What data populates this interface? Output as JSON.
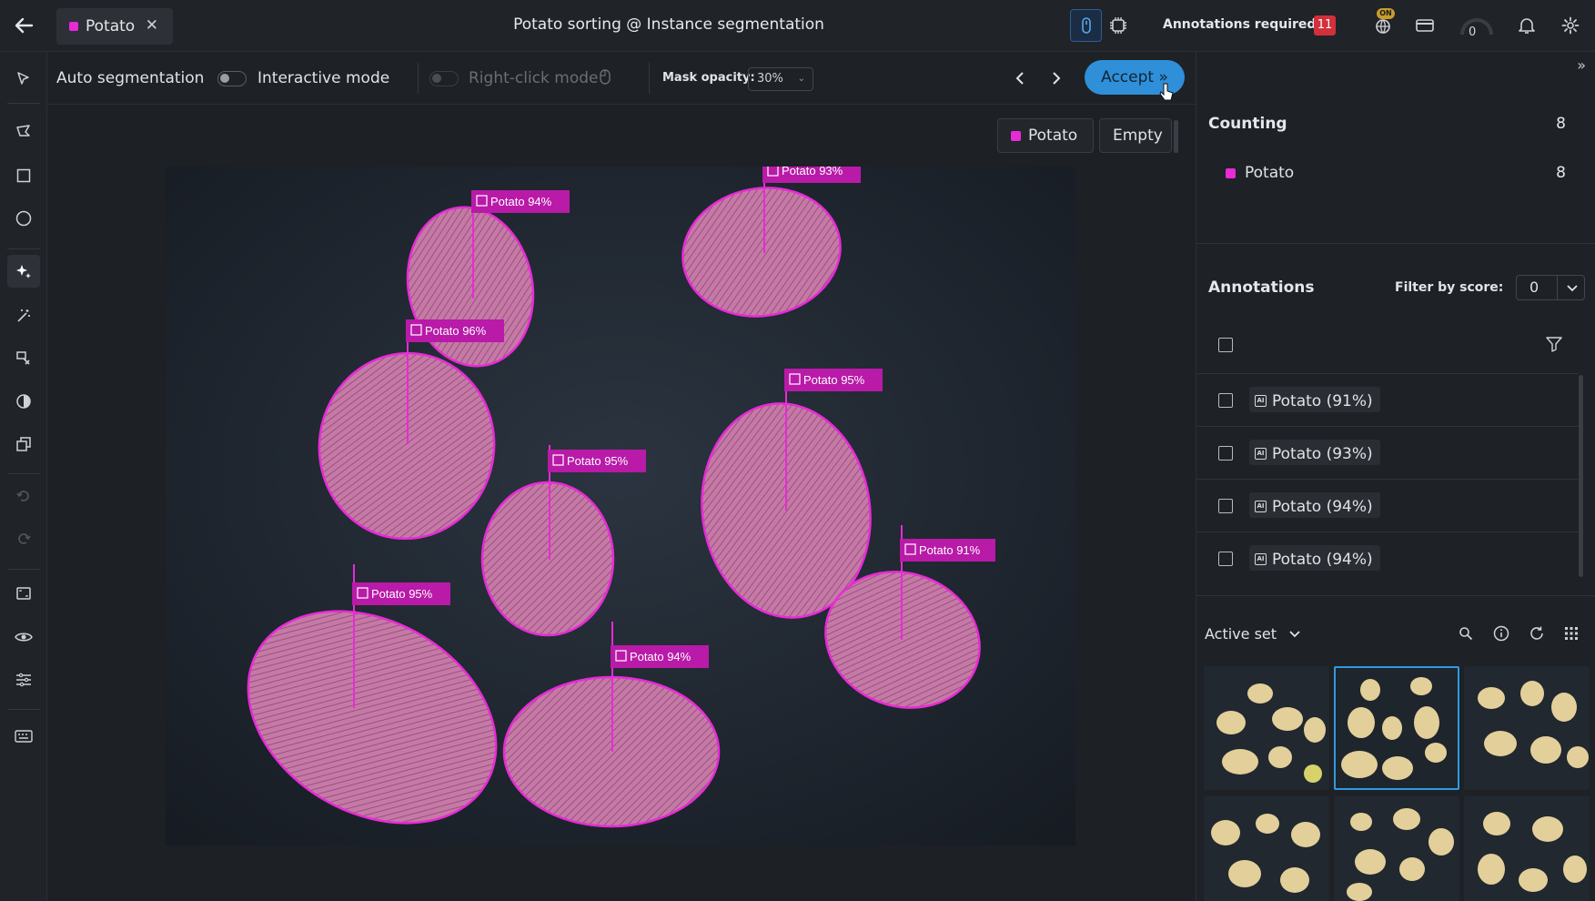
{
  "header": {
    "tab_label": "Potato",
    "title": "Potato sorting @ Instance segmentation",
    "annotations_required_label": "Annotations required:",
    "annotations_required_count": "11",
    "status_badge": "ON",
    "gauge_value": "0"
  },
  "toolbar": {
    "auto_segmentation": "Auto segmentation",
    "interactive_mode": "Interactive mode",
    "right_click_mode": "Right-click mode",
    "mask_opacity_label": "Mask opacity:",
    "mask_opacity_value": "30%",
    "accept_label": "Accept »"
  },
  "canvas": {
    "class_chip": "Potato",
    "empty_chip": "Empty",
    "labels": [
      {
        "text": "Potato 93%"
      },
      {
        "text": "Potato 94%"
      },
      {
        "text": "Potato 96%"
      },
      {
        "text": "Potato 95%"
      },
      {
        "text": "Potato 95%"
      },
      {
        "text": "Potato 91%"
      },
      {
        "text": "Potato 95%"
      },
      {
        "text": "Potato 94%"
      }
    ]
  },
  "panel": {
    "counting_title": "Counting",
    "counting_total": "8",
    "counting_class": "Potato",
    "counting_class_count": "8",
    "annotations_title": "Annotations",
    "filter_label": "Filter by score:",
    "filter_value": "0",
    "annotation_items": [
      {
        "label": "Potato (91%)"
      },
      {
        "label": "Potato (93%)"
      },
      {
        "label": "Potato (94%)"
      },
      {
        "label": "Potato (94%)"
      }
    ],
    "active_set_label": "Active set"
  },
  "colors": {
    "mask": "#e72bd6",
    "accent": "#2f8fd8",
    "badge_red": "#d2303a"
  }
}
